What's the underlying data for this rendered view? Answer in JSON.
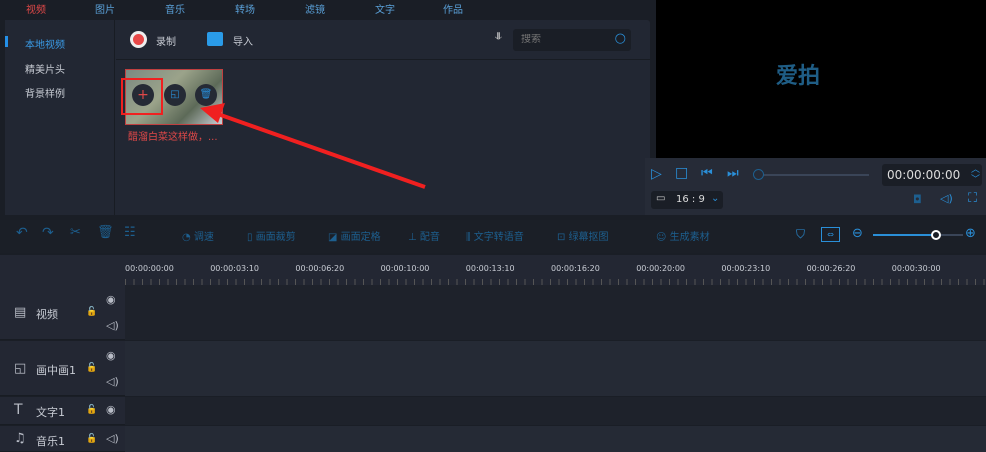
{
  "tabs": [
    "视频",
    "图片",
    "音乐",
    "转场",
    "滤镜",
    "文字",
    "作品"
  ],
  "sidebar": [
    "本地视频",
    "精美片头",
    "背景样例"
  ],
  "toolbar": {
    "record": "录制",
    "import": "导入",
    "search_placeholder": "搜索"
  },
  "media": [
    {
      "title": "醋溜白菜这样做，..."
    }
  ],
  "preview": {
    "logo": "爱拍",
    "time": "00:00:00:00",
    "ratio": "16 : 9"
  },
  "edit_tools": [
    "调速",
    "画面裁剪",
    "画面定格",
    "配音",
    "文字转语音",
    "绿幕抠图",
    "生成素材"
  ],
  "ruler": [
    "00:00:00:00",
    "00:00:03:10",
    "00:00:06:20",
    "00:00:10:00",
    "00:00:13:10",
    "00:00:16:20",
    "00:00:20:00",
    "00:00:23:10",
    "00:00:26:20",
    "00:00:30:00"
  ],
  "tracks": [
    "视频",
    "画中画1",
    "文字1",
    "音乐1"
  ],
  "zoom_level": 0.7
}
